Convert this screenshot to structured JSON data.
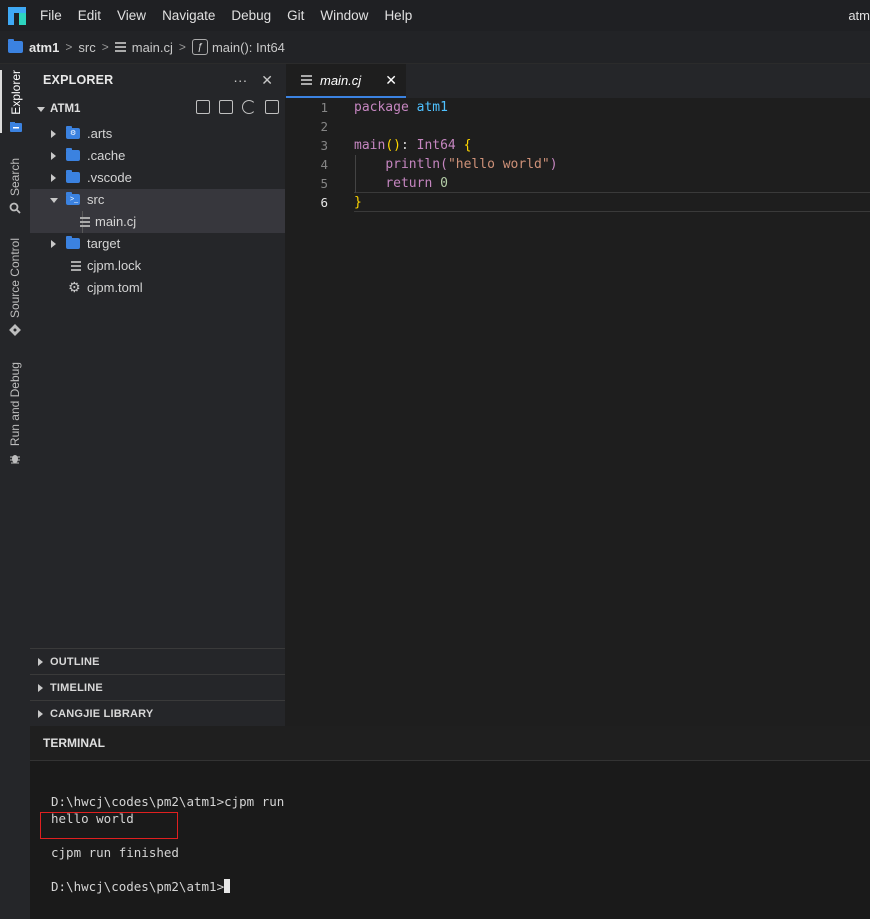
{
  "menubar": {
    "items": [
      "File",
      "Edit",
      "View",
      "Navigate",
      "Debug",
      "Git",
      "Window",
      "Help"
    ],
    "right_text": "atm"
  },
  "breadcrumb": {
    "project": "atm1",
    "folder": "src",
    "file": "main.cj",
    "symbol": "main(): Int64"
  },
  "activity": {
    "explorer": "Explorer",
    "search": "Search",
    "source_control": "Source Control",
    "run_debug": "Run and Debug"
  },
  "sidebar": {
    "title": "EXPLORER",
    "more": "···",
    "close": "✕",
    "project": "ATM1",
    "tree": [
      {
        "label": ".arts",
        "type": "folder",
        "expanded": false
      },
      {
        "label": ".cache",
        "type": "folder",
        "expanded": false
      },
      {
        "label": ".vscode",
        "type": "folder",
        "expanded": false
      },
      {
        "label": "src",
        "type": "folder",
        "expanded": true
      },
      {
        "label": "main.cj",
        "type": "file",
        "indent": 1
      },
      {
        "label": "target",
        "type": "folder",
        "expanded": false
      },
      {
        "label": "cjpm.lock",
        "type": "file"
      },
      {
        "label": "cjpm.toml",
        "type": "settings-file"
      }
    ],
    "sections": [
      "OUTLINE",
      "TIMELINE",
      "CANGJIE LIBRARY"
    ]
  },
  "editor": {
    "tab": {
      "label": "main.cj",
      "close": "✕"
    },
    "line_numbers": [
      "1",
      "2",
      "3",
      "4",
      "5",
      "6"
    ],
    "current_line": 6,
    "code": {
      "l1_kw": "package",
      "l1_ns": "atm1",
      "l3_fn": "main",
      "l3_paren": "()",
      "l3_colon": ": ",
      "l3_type": "Int64",
      "l3_brace": "{",
      "l4_fn": "println",
      "l4_open": "(",
      "l4_str": "\"hello world\"",
      "l4_close": ")",
      "l5_kw": "return",
      "l5_num": "0",
      "l6_brace": "}"
    }
  },
  "terminal": {
    "title": "TERMINAL",
    "lines": [
      "D:\\hwcj\\codes\\pm2\\atm1>cjpm run",
      "hello world",
      "cjpm run finished",
      "D:\\hwcj\\codes\\pm2\\atm1>"
    ],
    "highlight_color": "#e02020"
  },
  "colors": {
    "accent": "#3b82e0",
    "keyword": "#c586c0",
    "namespace": "#4fc1ff",
    "string": "#ce9178",
    "bracket": "#ffd700"
  }
}
